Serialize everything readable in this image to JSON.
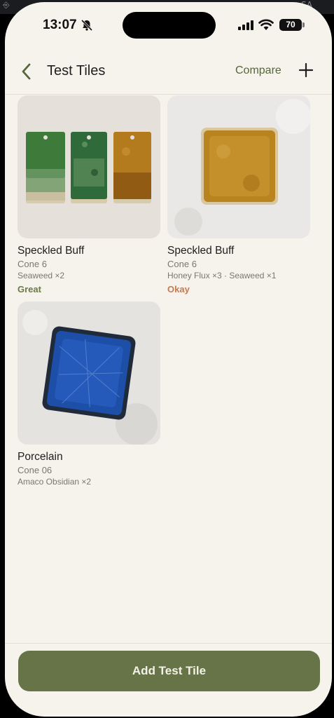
{
  "background_glyphs": {
    "left": "⎆",
    "right": "SA"
  },
  "status_bar": {
    "time": "13:07",
    "battery": "70"
  },
  "nav": {
    "title": "Test Tiles",
    "compare_label": "Compare"
  },
  "tiles": [
    {
      "title": "Speckled Buff",
      "cone": "Cone 6",
      "glazes": "Seaweed ×2",
      "rating": "Great",
      "rating_color": "#6a7a4a",
      "image": "three-rectangular-test-tiles-green-and-amber"
    },
    {
      "title": "Speckled Buff",
      "cone": "Cone 6",
      "glazes": "Honey Flux ×3 · Seaweed ×1",
      "rating": "Okay",
      "rating_color": "#c47a55",
      "image": "square-amber-tile"
    },
    {
      "title": "Porcelain",
      "cone": "Cone 06",
      "glazes": "Amaco Obsidian ×2",
      "rating": "",
      "image": "square-blue-crackle-tile"
    }
  ],
  "footer": {
    "add_button_label": "Add Test Tile"
  },
  "colors": {
    "background": "#f6f3ec",
    "accent": "#667447",
    "compare_text": "#55663a"
  }
}
